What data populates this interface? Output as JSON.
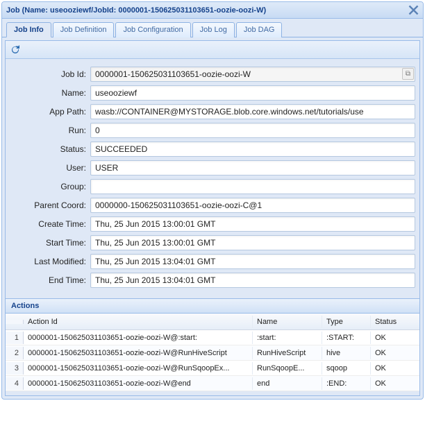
{
  "window": {
    "title": "Job (Name: useooziewf/JobId: 0000001-150625031103651-oozie-oozi-W)"
  },
  "tabs": [
    {
      "label": "Job Info",
      "active": true
    },
    {
      "label": "Job Definition",
      "active": false
    },
    {
      "label": "Job Configuration",
      "active": false
    },
    {
      "label": "Job Log",
      "active": false
    },
    {
      "label": "Job DAG",
      "active": false
    }
  ],
  "form": {
    "fields": [
      {
        "label": "Job Id:",
        "value": "0000001-150625031103651-oozie-oozi-W",
        "trigger": true
      },
      {
        "label": "Name:",
        "value": "useooziewf"
      },
      {
        "label": "App Path:",
        "value": "wasb://CONTAINER@MYSTORAGE.blob.core.windows.net/tutorials/use"
      },
      {
        "label": "Run:",
        "value": "0"
      },
      {
        "label": "Status:",
        "value": "SUCCEEDED"
      },
      {
        "label": "User:",
        "value": "USER"
      },
      {
        "label": "Group:",
        "value": ""
      },
      {
        "label": "Parent Coord:",
        "value": "0000000-150625031103651-oozie-oozi-C@1"
      },
      {
        "label": "Create Time:",
        "value": "Thu, 25 Jun 2015 13:00:01 GMT"
      },
      {
        "label": "Start Time:",
        "value": "Thu, 25 Jun 2015 13:00:01 GMT"
      },
      {
        "label": "Last Modified:",
        "value": "Thu, 25 Jun 2015 13:04:01 GMT"
      },
      {
        "label": "End Time:",
        "value": "Thu, 25 Jun 2015 13:04:01 GMT"
      }
    ]
  },
  "actions": {
    "title": "Actions",
    "columns": {
      "num": "",
      "action_id": "Action Id",
      "name": "Name",
      "type": "Type",
      "status": "Status"
    },
    "rows": [
      {
        "num": "1",
        "action_id": "0000001-150625031103651-oozie-oozi-W@:start:",
        "name": ":start:",
        "type": ":START:",
        "status": "OK"
      },
      {
        "num": "2",
        "action_id": "0000001-150625031103651-oozie-oozi-W@RunHiveScript",
        "name": "RunHiveScript",
        "type": "hive",
        "status": "OK"
      },
      {
        "num": "3",
        "action_id": "0000001-150625031103651-oozie-oozi-W@RunSqoopEx...",
        "name": "RunSqoopE...",
        "type": "sqoop",
        "status": "OK"
      },
      {
        "num": "4",
        "action_id": "0000001-150625031103651-oozie-oozi-W@end",
        "name": "end",
        "type": ":END:",
        "status": "OK"
      }
    ]
  }
}
